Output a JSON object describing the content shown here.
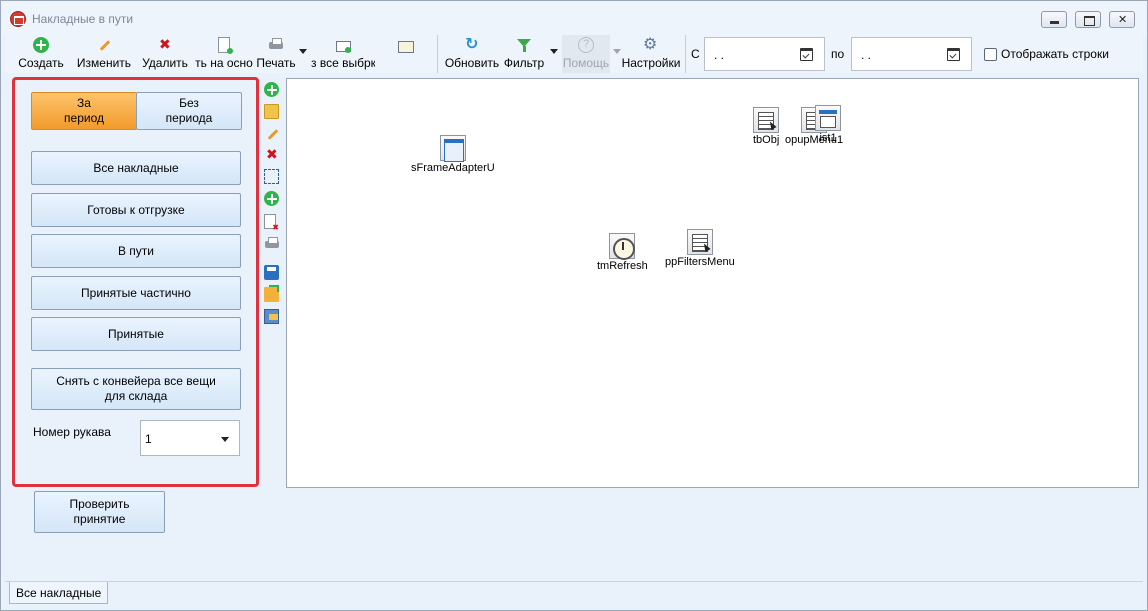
{
  "window": {
    "title": "Накладные в пути"
  },
  "toolbar": {
    "create": "Создать",
    "edit": "Изменить",
    "delete": "Удалить",
    "create_based": "ть на осно",
    "print": "Печать",
    "from_selection": "з все выбрка через СI",
    "refresh": "Обновить",
    "filter": "Фильтр",
    "help": "Помощь",
    "settings": "Настройки",
    "date_from_label": "С",
    "date_from_value": ". .",
    "date_to_label": "по",
    "date_to_value": ". .",
    "show_rows_label": "Отображать строки",
    "show_rows_checked": false
  },
  "left_panel": {
    "period_button": "За\nпериод",
    "no_period_button": "Без\nпериода",
    "all_invoices": "Все накладные",
    "ready_to_ship": "Готовы к отгрузке",
    "in_transit": "В пути",
    "partially_received": "Принятые частично",
    "received": "Принятые",
    "remove_from_conveyor": "Снять с конвейера все вещи\nдля склада",
    "sleeve_label": "Номер рукава",
    "sleeve_value": "1"
  },
  "check_button": "Проверить\nпринятие",
  "canvas_components": {
    "frame_adapter": "sFrameAdapterU",
    "tb_obj": "tbObj",
    "popup_menu": "opupMenu1",
    "list1": "ist1",
    "tm_refresh": "tmRefresh",
    "filters_menu": "ppFiltersMenu"
  },
  "tabs": {
    "active": "Все накладные"
  },
  "colors": {
    "highlight_border": "#e0313e",
    "active_button": "#f29a2c",
    "window_bg": "#e9f1fb"
  }
}
